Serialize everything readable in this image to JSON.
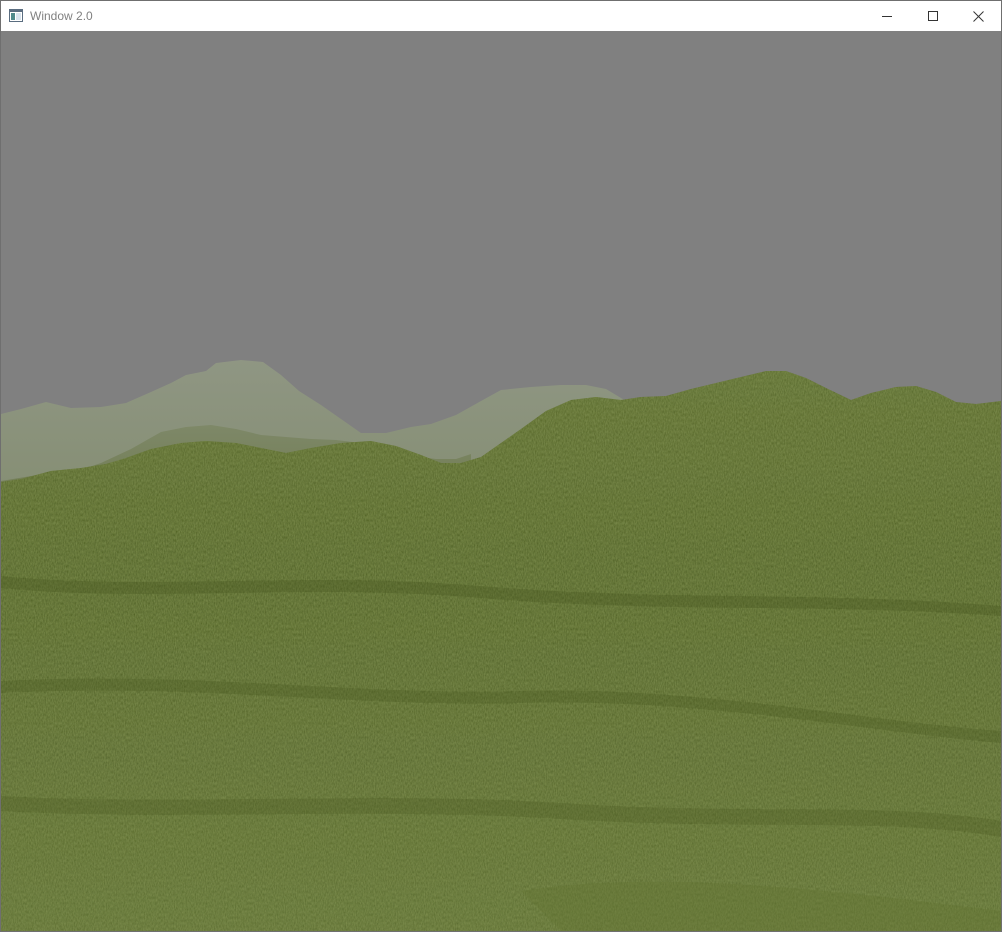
{
  "window": {
    "title": "Window 2.0",
    "app_icon": "app-window-icon",
    "controls": {
      "minimize_icon": "minimize-icon",
      "maximize_icon": "maximize-icon",
      "close_icon": "close-icon"
    }
  },
  "scene": {
    "description_type": "3d-terrain-render",
    "sky_color": "#808080",
    "fog_color": "#8e9580",
    "grass_color": "#4e5f1f",
    "grass_dark": "#3f4f18",
    "grass_light": "#5d6e2a"
  }
}
